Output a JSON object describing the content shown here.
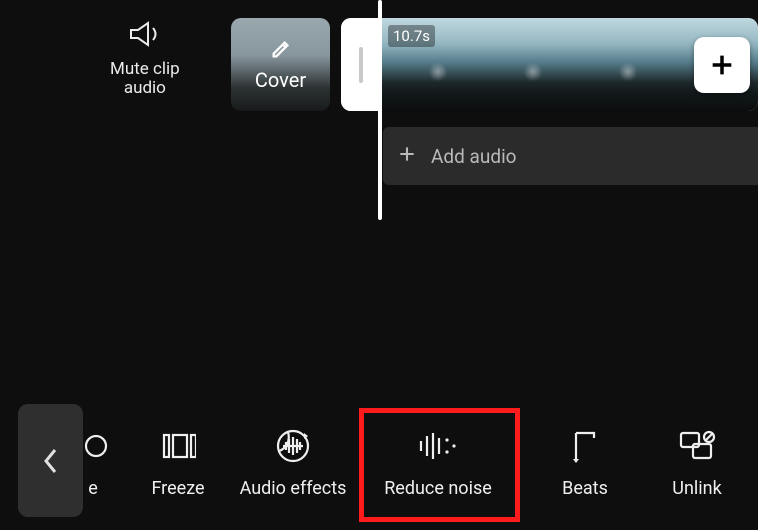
{
  "timeline": {
    "mute_label": "Mute clip\naudio",
    "cover_label": "Cover",
    "clip_duration": "10.7s",
    "add_audio_label": "Add audio"
  },
  "tools": {
    "cut_off_label": "e",
    "freeze_label": "Freeze",
    "audio_effects_label": "Audio effects",
    "reduce_noise_label": "Reduce noise",
    "beats_label": "Beats",
    "unlink_label": "Unlink"
  },
  "highlight": "reduce_noise"
}
